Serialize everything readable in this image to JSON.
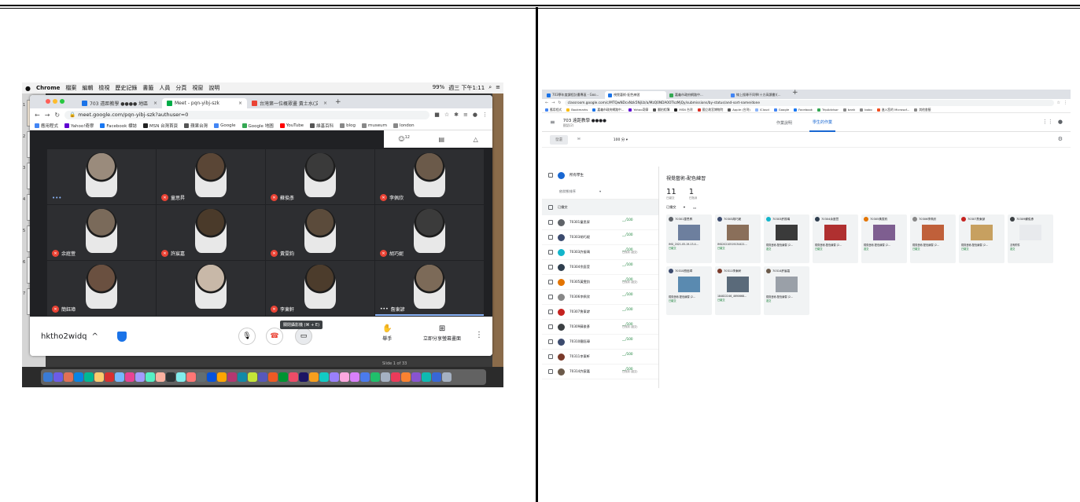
{
  "meet": {
    "mac_menu": {
      "app": "Chrome",
      "items": [
        "檔案",
        "編輯",
        "檢視",
        "歷史記錄",
        "書籤",
        "人員",
        "分頁",
        "視窗",
        "說明"
      ],
      "status": "99%",
      "clock": "週三 下午1:11"
    },
    "tabs": [
      {
        "label": "703 遠距教學 ●●●● 地區(2...",
        "color": "#1a73e8"
      },
      {
        "label": "Meet - pqn-yibj-szk",
        "color": "#00ac47"
      },
      {
        "label": "台灣第一位概眾畫 黃土水(文化...",
        "color": "#ea4335"
      }
    ],
    "url": "meet.google.com/pqn-yibj-szk?authuser=0",
    "bookmarks": [
      {
        "label": "應用程式",
        "color": "#4285f4"
      },
      {
        "label": "Yahoo!奇摩",
        "color": "#5f01d1"
      },
      {
        "label": "Facebook 標誌",
        "color": "#1877f2"
      },
      {
        "label": "MSN 台灣首頁",
        "color": "#222"
      },
      {
        "label": "蘋果台灣",
        "color": "#555"
      },
      {
        "label": "Google",
        "color": "#4285f4"
      },
      {
        "label": "Google 地圖",
        "color": "#34a853"
      },
      {
        "label": "YouTube",
        "color": "#ff0000"
      },
      {
        "label": "維基百科",
        "color": "#555"
      },
      {
        "label": "blog",
        "color": "#888"
      },
      {
        "label": "museum",
        "color": "#888"
      },
      {
        "label": "london",
        "color": "#888"
      }
    ],
    "participant_count": "12",
    "participants": [
      {
        "name": "",
        "muted": false,
        "color": "#9a8b7c",
        "self": true
      },
      {
        "name": "童思昇",
        "muted": true,
        "color": "#5a4636"
      },
      {
        "name": "蘇俊彥",
        "muted": true,
        "color": "#3a3a3a"
      },
      {
        "name": "李佩欣",
        "muted": true,
        "color": "#6b5a4a"
      },
      {
        "name": "余庭萱",
        "muted": true,
        "color": "#7a6a5a"
      },
      {
        "name": "許宸嘉",
        "muted": true,
        "color": "#4a3a2a"
      },
      {
        "name": "黃雯鈞",
        "muted": true,
        "color": "#5b4b3b"
      },
      {
        "name": "胡巧妮",
        "muted": true,
        "color": "#3b3b3b"
      },
      {
        "name": "簡鈺璋",
        "muted": true,
        "color": "#6a5040"
      },
      {
        "name": "",
        "muted": false,
        "color": "#c8b8a8",
        "hidden_name": true
      },
      {
        "name": "李東軒",
        "muted": true,
        "color": "#4c3c2c"
      },
      {
        "name": "詹東諺",
        "muted": false,
        "color": "#7c6a58",
        "speaking": true
      }
    ],
    "tooltip": "關閉攝影機 (⌘ + E)",
    "meeting_code": "hktho2widq",
    "raise_hand": "舉手",
    "present_now": "立即分享螢幕畫面",
    "slide_status": "Slide 1 of 33"
  },
  "classroom": {
    "tabs": [
      {
        "label": "703學年度課程計畫專區 - Goo...",
        "color": "#1a73e8"
      },
      {
        "label": "視覺藝術-配色練習",
        "color": "#1a73e8"
      },
      {
        "label": "嘉義市政府網路中...",
        "color": "#34a853"
      },
      {
        "label": "線上搜尋不同學(十方高讀書)(...",
        "color": "#4285f4"
      }
    ],
    "url": "classroom.google.com/c/MTQwNDcxNzk5NjUz/a/MzQ0NDA0OTkzMjQy/submissions/by-status/and-sort-name/done",
    "bookmarks": [
      "應用程式",
      "Bookmarks",
      "嘉義市政府網路中...",
      "Yahoo奇摩",
      "翻拍相簿",
      "MSN 台灣",
      "國立故宮博物院",
      "Apple (台灣)",
      "iCloud",
      "Google",
      "Facebook",
      "TripAdvisor",
      "bank",
      "bobo",
      "進入您的 Microsof...",
      "其他書籤"
    ],
    "class_title": "703 遠距教學 ●●●●",
    "class_sub": "國語(2)",
    "nav": [
      "作業說明",
      "學生的作業"
    ],
    "return_label": "發還",
    "points": "100 分",
    "all_students": "所有學生",
    "sort_label": "依狀態排序",
    "group_label": "已繳交",
    "assignment_title": "視覺藝術-配色練習",
    "stats": [
      {
        "num": "11",
        "label": "已繳交"
      },
      {
        "num": "1",
        "label": "已指派"
      }
    ],
    "filter": "已繳交",
    "students": [
      {
        "name": "70301童思昇",
        "grade": "__/100",
        "note": "",
        "color": "#5f6368"
      },
      {
        "name": "70303胡巧妮",
        "grade": "__/100",
        "note": "",
        "color": "#3c4b6e"
      },
      {
        "name": "70303許振瑀",
        "grade": "__/100",
        "note": "已改用 (遲交)",
        "color": "#12b5cb"
      },
      {
        "name": "70304余庭萱",
        "grade": "__/100",
        "note": "",
        "color": "#2f3e4e"
      },
      {
        "name": "70305黃雯鈞",
        "grade": "__/100",
        "note": "已改用 (遲交)",
        "color": "#e37400"
      },
      {
        "name": "70306李佩欣",
        "grade": "__/100",
        "note": "",
        "color": "#888888"
      },
      {
        "name": "70307詹東諺",
        "grade": "__/100",
        "note": "",
        "color": "#c5221f"
      },
      {
        "name": "70309蘇俊彥",
        "grade": "__/100",
        "note": "已改用 (遲交)",
        "color": "#3c4043"
      },
      {
        "name": "70310簡鈺璋",
        "grade": "__/100",
        "note": "",
        "color": "#3c4b6e"
      },
      {
        "name": "70311李東軒",
        "grade": "__/100",
        "note": "",
        "color": "#7a3a2a"
      },
      {
        "name": "70314許宸嘉",
        "grade": "__/100",
        "note": "已改用 (遲交)",
        "color": "#6b5a4a"
      }
    ],
    "cards": [
      {
        "name": "70301童思昇",
        "file": "IMG_2021-05-19-13-4...",
        "status": "已繳交",
        "color": "#5f6368",
        "thumb": "#6d7f9e"
      },
      {
        "name": "70303胡巧妮",
        "file": "IMG20210519134421...",
        "status": "已繳交",
        "color": "#3c4b6e",
        "thumb": "#8a6f5a"
      },
      {
        "name": "70303許振瑀",
        "file": "視覺藝術-配色練習 (2...",
        "status": "遲交",
        "color": "#12b5cb",
        "thumb": "#3a3a3a"
      },
      {
        "name": "70304余庭萱",
        "file": "視覺藝術-配色練習 (2...",
        "status": "已繳交",
        "color": "#2f3e4e",
        "thumb": "#b03030"
      },
      {
        "name": "70305黃雯鈞",
        "file": "視覺藝術-配色練習 (2...",
        "status": "遲交",
        "color": "#e37400",
        "thumb": "#7e5e90"
      },
      {
        "name": "70306李佩欣",
        "file": "視覺藝術-配色練習 (2...",
        "status": "已繳交",
        "color": "#888888",
        "thumb": "#c0603a"
      },
      {
        "name": "70307詹東諺",
        "file": "視覺藝術-配色練習 (2...",
        "status": "已繳交",
        "color": "#c5221f",
        "thumb": "#c7a060"
      },
      {
        "name": "70309蘇俊彥",
        "file": "沒有附件",
        "status": "遲交",
        "color": "#3c4043",
        "thumb": ""
      },
      {
        "name": "70310簡鈺璋",
        "file": "視覺藝術-配色練習 (2...",
        "status": "已繳交",
        "color": "#3c4b6e",
        "thumb": "#5a8ab0"
      },
      {
        "name": "70311李東軒",
        "file": "184822246_4690668...",
        "status": "已繳交",
        "color": "#7a3a2a",
        "thumb": "#5a6a7a"
      },
      {
        "name": "70314許宸嘉",
        "file": "視覺藝術-配色練習 (2...",
        "status": "遲交",
        "color": "#6b5a4a",
        "thumb": "#9aa0a8"
      }
    ]
  }
}
